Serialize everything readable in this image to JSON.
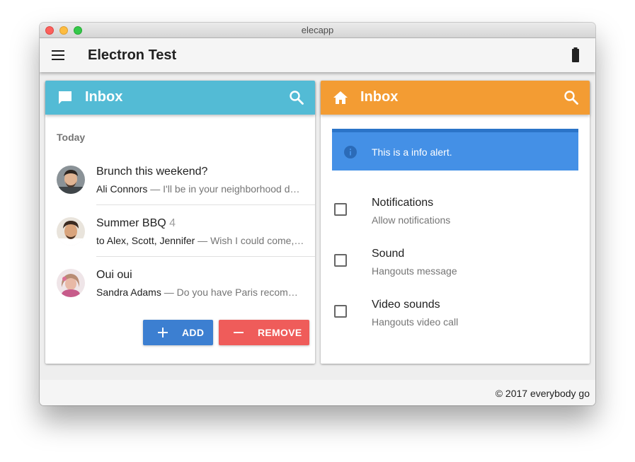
{
  "window": {
    "title": "elecapp"
  },
  "appbar": {
    "title": "Electron Test",
    "menu_icon": "menu-icon",
    "status_icon": "battery-icon"
  },
  "left_card": {
    "toolbar": {
      "title": "Inbox",
      "color": "#53bbd5",
      "icon": "chat-bubble-icon",
      "action_icon": "search-icon"
    },
    "subheader": "Today",
    "items": [
      {
        "title": "Brunch this weekend?",
        "count": "",
        "who": "Ali Connors",
        "snippet": " — I'll be in your neighborhood doing errands this weekend. Do you want to hang out?"
      },
      {
        "title": "Summer BBQ",
        "count": "4",
        "who": "to Alex, Scott, Jennifer",
        "snippet": " — Wish I could come, but I'm out of town this weekend."
      },
      {
        "title": "Oui oui",
        "count": "",
        "who": "Sandra Adams",
        "snippet": " — Do you have Paris recommendations? Have you ever been?"
      }
    ],
    "buttons": {
      "add_label": "ADD",
      "add_color": "#3c7fd1",
      "remove_label": "REMOVE",
      "remove_color": "#ef5c5a"
    }
  },
  "right_card": {
    "toolbar": {
      "title": "Inbox",
      "color": "#f39c33",
      "icon": "home-icon",
      "action_icon": "search-icon"
    },
    "alert": {
      "text": "This is a info alert.",
      "icon": "info-icon",
      "color": "#4490e6"
    },
    "settings": [
      {
        "title": "Notifications",
        "subtitle": "Allow notifications",
        "checked": false
      },
      {
        "title": "Sound",
        "subtitle": "Hangouts message",
        "checked": false
      },
      {
        "title": "Video sounds",
        "subtitle": "Hangouts video call",
        "checked": false
      }
    ]
  },
  "footer": {
    "text": "© 2017 everybody go"
  }
}
